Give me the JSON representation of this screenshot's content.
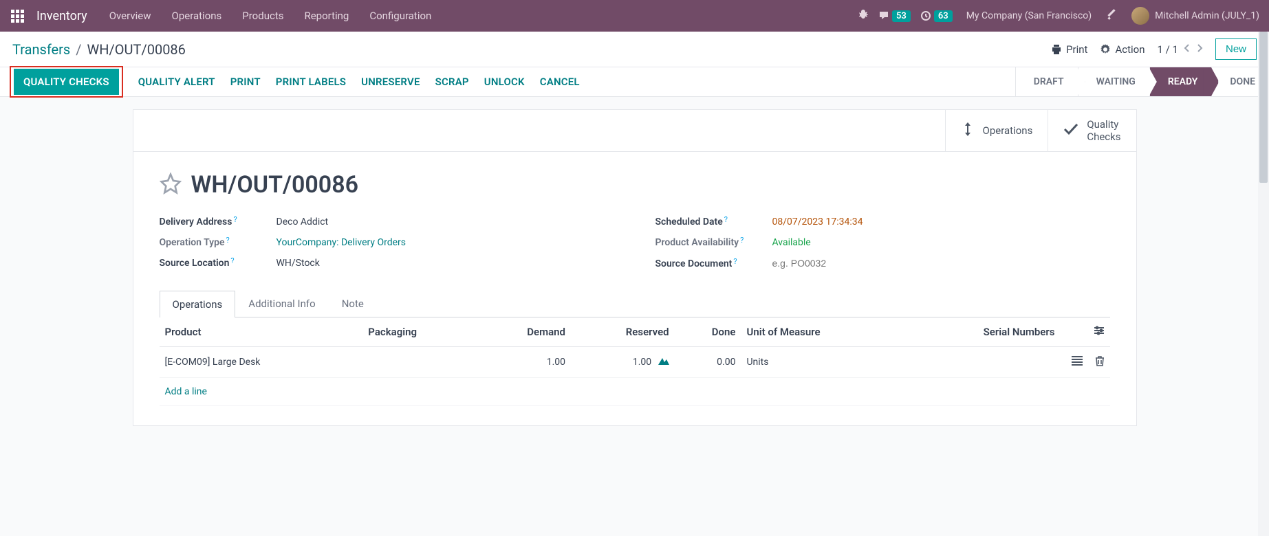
{
  "navbar": {
    "app_title": "Inventory",
    "links": [
      "Overview",
      "Operations",
      "Products",
      "Reporting",
      "Configuration"
    ],
    "messages_badge": "53",
    "activities_badge": "63",
    "company": "My Company (San Francisco)",
    "user": "Mitchell Admin (JULY_1)"
  },
  "control": {
    "breadcrumb_root": "Transfers",
    "breadcrumb_current": "WH/OUT/00086",
    "print": "Print",
    "action": "Action",
    "pager": "1 / 1",
    "new": "New"
  },
  "actions": {
    "quality_checks": "QUALITY CHECKS",
    "quality_alert": "QUALITY ALERT",
    "print": "PRINT",
    "print_labels": "PRINT LABELS",
    "unreserve": "UNRESERVE",
    "scrap": "SCRAP",
    "unlock": "UNLOCK",
    "cancel": "CANCEL"
  },
  "status_steps": [
    "DRAFT",
    "WAITING",
    "READY",
    "DONE"
  ],
  "stat_buttons": {
    "operations": "Operations",
    "quality_checks": "Quality\nChecks"
  },
  "record": {
    "name": "WH/OUT/00086",
    "fields": {
      "delivery_address": {
        "label": "Delivery Address",
        "value": "Deco Addict"
      },
      "operation_type": {
        "label": "Operation Type",
        "value": "YourCompany: Delivery Orders"
      },
      "source_location": {
        "label": "Source Location",
        "value": "WH/Stock"
      },
      "scheduled_date": {
        "label": "Scheduled Date",
        "value": "08/07/2023 17:34:34"
      },
      "product_availability": {
        "label": "Product Availability",
        "value": "Available"
      },
      "source_document": {
        "label": "Source Document",
        "placeholder": "e.g. PO0032"
      }
    }
  },
  "tabs": [
    "Operations",
    "Additional Info",
    "Note"
  ],
  "table": {
    "headers": {
      "product": "Product",
      "packaging": "Packaging",
      "demand": "Demand",
      "reserved": "Reserved",
      "done": "Done",
      "uom": "Unit of Measure",
      "serial": "Serial Numbers"
    },
    "rows": [
      {
        "product": "[E-COM09] Large Desk",
        "packaging": "",
        "demand": "1.00",
        "reserved": "1.00",
        "done": "0.00",
        "uom": "Units"
      }
    ],
    "add_line": "Add a line"
  }
}
